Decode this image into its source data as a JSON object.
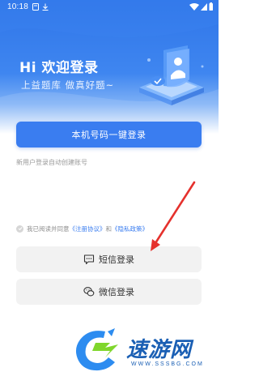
{
  "status_bar": {
    "time": "10:18"
  },
  "hero": {
    "title": "Hi 欢迎登录",
    "subtitle": "上益题库  做真好题~"
  },
  "login": {
    "one_click_label": "本机号码一键登录",
    "auto_register_note": "新用户登录自动创建账号",
    "agreement_prefix": "我已阅读并同意",
    "agreement_link_1": "《注册协议》",
    "agreement_and": "和",
    "agreement_link_2": "《隐私政策》",
    "sms_label": "短信登录",
    "wechat_label": "微信登录"
  },
  "watermark": {
    "name": "速游网",
    "url": "WWW.SSSBG.COM"
  },
  "colors": {
    "primary": "#3a7df0",
    "hero_top": "#2f75e8",
    "secondary_button_bg": "#f2f2f2",
    "annotation_arrow": "#e5312d",
    "watermark": "#1a5fb4"
  }
}
